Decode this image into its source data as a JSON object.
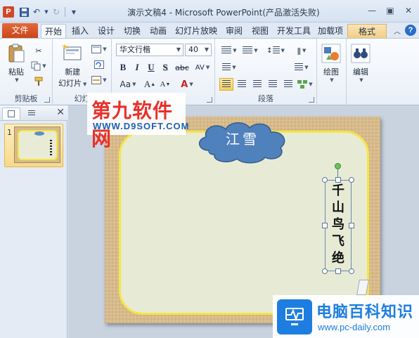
{
  "window": {
    "title": "演示文稿4  -  Microsoft PowerPoint(产品激活失败)",
    "app_icon_letter": "P"
  },
  "tabs": {
    "file": "文件",
    "items": [
      "开始",
      "插入",
      "设计",
      "切换",
      "动画",
      "幻灯片放映",
      "审阅",
      "视图",
      "开发工具",
      "加载项",
      "格式"
    ]
  },
  "ribbon": {
    "clipboard": {
      "paste": "粘贴",
      "label": "剪贴板"
    },
    "slides": {
      "new_slide_line1": "新建",
      "new_slide_line2": "幻灯片",
      "label": "幻灯"
    },
    "font": {
      "name": "华文行楷",
      "size": "40",
      "bold": "B",
      "italic": "I",
      "underline": "U",
      "shadow": "S",
      "strike": "abc",
      "spacing": "AV",
      "case": "Aa",
      "grow": "A",
      "shrink": "A",
      "color": "A"
    },
    "paragraph": {
      "label": "段落"
    },
    "drawing": {
      "label": "绘图"
    },
    "editing": {
      "label": "编辑"
    }
  },
  "pane": {
    "slide_number": "1"
  },
  "slide": {
    "cloud_text": "江雪",
    "vertical_text": [
      "千",
      "山",
      "鸟",
      "飞",
      "绝"
    ]
  },
  "watermarks": {
    "top_line1": "第九软件网",
    "top_line2": "WWW.D9SOFT.COM",
    "bottom_line1": "电脑百科知识",
    "bottom_line2": "www.pc-daily.com"
  },
  "colors": {
    "file_tab": "#d24726",
    "cloud_fill": "#4f81bd",
    "panel_border": "#f5e645",
    "slide_bg": "#dcc193"
  }
}
